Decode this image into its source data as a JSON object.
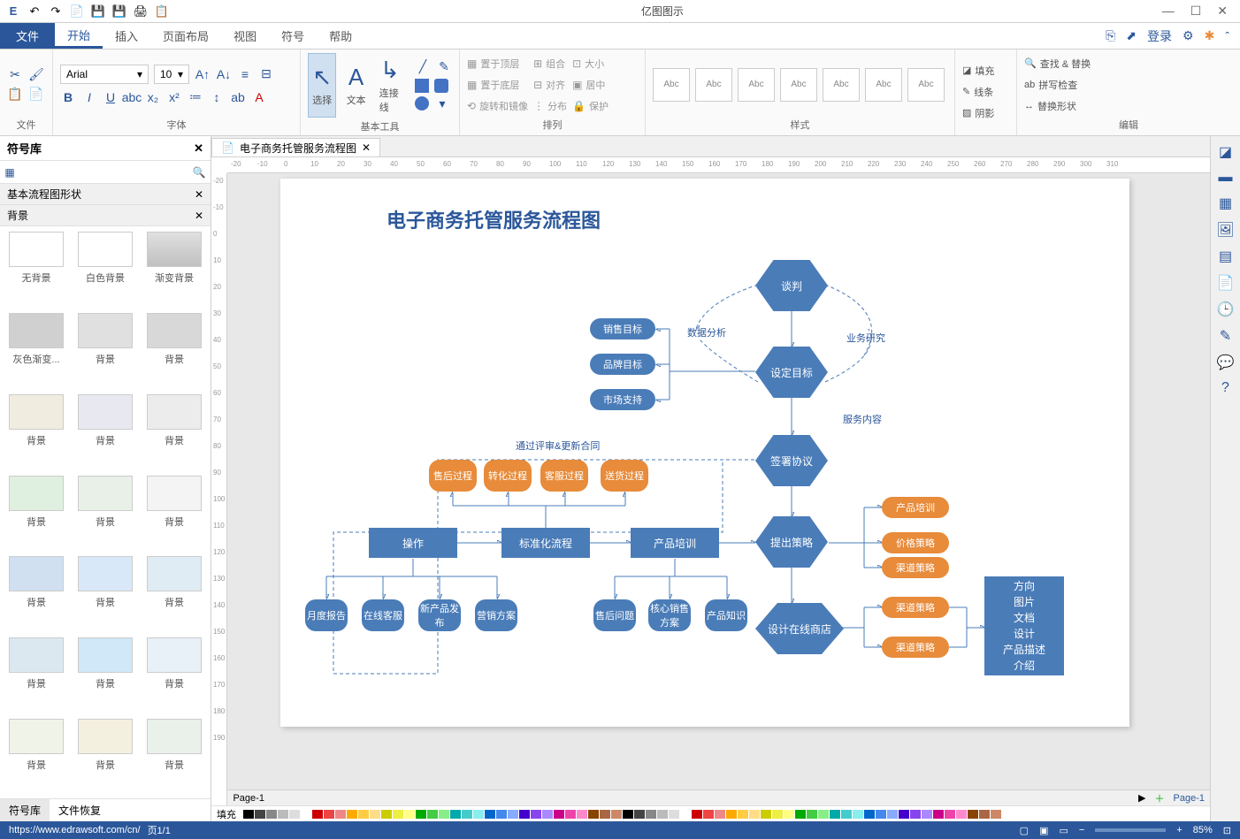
{
  "app_title": "亿图图示",
  "qat_icons": [
    "↶",
    "↷",
    "📄",
    "💾",
    "💾",
    "🖨",
    "📋"
  ],
  "win_icons": [
    "—",
    "☐",
    "✕"
  ],
  "menu": {
    "file": "文件",
    "tabs": [
      "开始",
      "插入",
      "页面布局",
      "视图",
      "符号",
      "帮助"
    ],
    "active": "开始",
    "login": "登录"
  },
  "ribbon": {
    "file_label": "文件",
    "font": {
      "name": "Arial",
      "size": "10",
      "label": "字体"
    },
    "tools": {
      "select": "选择",
      "text": "文本",
      "connector": "连接线",
      "label": "基本工具"
    },
    "arrange": {
      "items": [
        "置于顶层",
        "置于底层",
        "旋转和镜像",
        "组合",
        "对齐",
        "分布",
        "大小",
        "居中",
        "保护"
      ],
      "label": "排列"
    },
    "styles": {
      "name": "Abc",
      "label": "样式"
    },
    "fill": {
      "fill": "填充",
      "line": "线条",
      "shadow": "阴影"
    },
    "edit": {
      "find": "查找 & 替换",
      "spell": "拼写检查",
      "replace_shape": "替换形状",
      "label": "编辑"
    }
  },
  "sidebar": {
    "title": "符号库",
    "categories": [
      "基本流程图形状",
      "背景"
    ],
    "items": [
      {
        "n": "无背景"
      },
      {
        "n": "白色背景"
      },
      {
        "n": "渐变背景"
      },
      {
        "n": "灰色渐变..."
      },
      {
        "n": "背景"
      },
      {
        "n": "背景"
      },
      {
        "n": "背景"
      },
      {
        "n": "背景"
      },
      {
        "n": "背景"
      },
      {
        "n": "背景"
      },
      {
        "n": "背景"
      },
      {
        "n": "背景"
      },
      {
        "n": "背景"
      },
      {
        "n": "背景"
      },
      {
        "n": "背景"
      },
      {
        "n": "背景"
      },
      {
        "n": "背景"
      },
      {
        "n": "背景"
      },
      {
        "n": "背景"
      },
      {
        "n": "背景"
      },
      {
        "n": "背景"
      }
    ],
    "tabs": [
      "符号库",
      "文件恢复"
    ]
  },
  "doc_tab": "电子商务托管服务流程图",
  "flowchart": {
    "title": "电子商务托管服务流程图",
    "hex": {
      "negotiate": "谈判",
      "set_goal": "设定目标",
      "sign": "签署协议",
      "propose": "提出策略",
      "design": "设计在线商店"
    },
    "rrect": {
      "sales": "销售目标",
      "brand": "品牌目标",
      "market": "市场支持",
      "monthly": "月度报告",
      "online": "在线客服",
      "newprod": "新产品发布",
      "marketing": "营销方案",
      "after": "售后问题",
      "core": "核心销售方案",
      "prodknow": "产品知识"
    },
    "orect": {
      "after_proc": "售后过程",
      "convert": "转化过程",
      "cs_proc": "客服过程",
      "deliver": "送货过程",
      "train": "产品培训",
      "price": "价格策略",
      "channel1": "渠道策略",
      "channel2": "渠道策略",
      "channel3": "渠道策略"
    },
    "rect": {
      "operate": "操作",
      "standard": "标准化流程",
      "training": "产品培训",
      "outcome": "方向\n图片\n文档\n设计\n产品描述\n介绍"
    },
    "labels": {
      "data": "数据分析",
      "biz": "业务研究",
      "service": "服务内容",
      "review": "通过评审&更新合同"
    }
  },
  "page": {
    "tab": "Page-1",
    "tab2": "Page-1",
    "fill": "填充"
  },
  "status": {
    "url": "https://www.edrawsoft.com/cn/",
    "page": "页1/1",
    "zoom": "85%"
  },
  "ruler_marks": [
    -20,
    -10,
    0,
    10,
    20,
    30,
    40,
    50,
    60,
    70,
    80,
    90,
    100,
    110,
    120,
    130,
    140,
    150,
    160,
    170,
    180,
    190,
    200,
    210,
    220,
    230,
    240,
    250,
    260,
    270,
    280,
    290,
    300,
    310
  ]
}
